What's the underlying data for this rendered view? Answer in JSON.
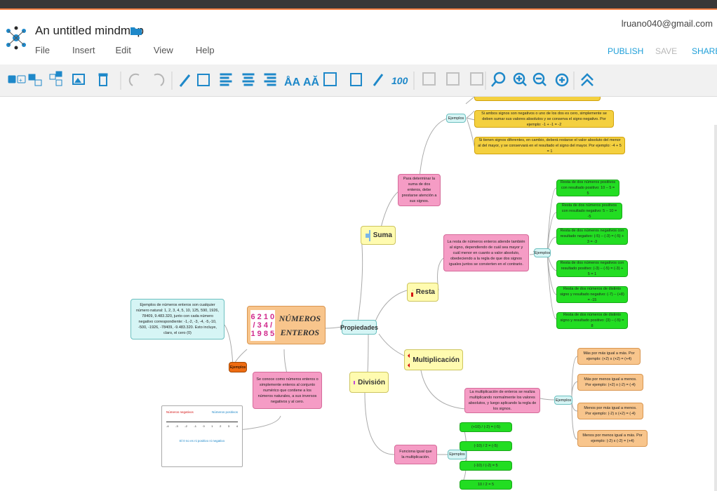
{
  "app": {
    "title": "An untitled mindmap",
    "user": "lruano040@gmail.com",
    "menu": [
      "File",
      "Insert",
      "Edit",
      "View",
      "Help"
    ],
    "buttons": {
      "publish": "PUBLISH",
      "save": "SAVE",
      "share": "SHARE"
    }
  },
  "toolbar": {
    "icons": [
      "add-topic-icon",
      "add-subtopic-icon",
      "add-relationship-icon",
      "add-image-icon",
      "delete-icon",
      "undo-icon",
      "redo-icon",
      "connector-icon",
      "text-style-icon",
      "align-left-icon",
      "align-center-icon",
      "align-right-icon",
      "font-increase-icon",
      "font-decrease-icon",
      "image-icon",
      "calendar-icon",
      "attachment-icon",
      "note-icon",
      "checklist-icon",
      "checklist-icon-2",
      "checklist-icon-3",
      "search-icon",
      "zoom-in-icon",
      "zoom-out-icon",
      "fit-icon",
      "collapse-icon"
    ]
  },
  "mindmap": {
    "center_title": "NÚMEROS ENTEROS",
    "center_digits": "6 2 1 0 / 3 4 / 1 9 8 5",
    "properties": "Propiedades",
    "suma": "Suma",
    "resta": "Resta",
    "multiplicacion": "Multiplicación",
    "division": "División",
    "ejemplos": "Ejemplos",
    "suma_desc": "Para determinar la suma de dos enteros, debe prestarse atención a sus signos.",
    "suma_ej1": "Si ambos signos son negativos o uno de los dos es cero, simplemente se deben sumar sus valores absolutos y se conserva el signo negativo. Por ejemplo: -1 + -1 = -2",
    "suma_ej2": "Si tienen signos diferentes, en cambio, deberá restarse el valor absoluto del menor al del mayor, y se conservará en el resultado el signo del mayor. Por ejemplo: -4 + 5 = 1",
    "resta_desc": "La resta de números enteros atiende también al signo, dependiendo de cuál sea mayor y cuál menor en cuanto a valor absoluto, obedeciendo a la regla de que dos signos iguales juntos se convierten en el contrario.",
    "resta_ej": [
      "Resta de dos números positivos con resultado positivo: 10 – 5 = 5",
      "Resta de dos números positivos con resultado negativo: 5 – 10 = -5",
      "Resta de dos números negativos con resultado negativo: (-5) – (-3) = (-5) + 3 = -3",
      "Resta de dos números negativos con resultado positivo: (-3) – (-5) = (-3) + 5 = 1",
      "Resta de dos números de distinto signo y resultado negativo: (-7) – (+8) = -15",
      "Resta de dos números de distinto signo y resultado positivo: (3) – (-5) = 8"
    ],
    "multi_desc": "La multiplicación de enteros se realiza multiplicando normalmente los valores absolutos, y luego aplicando la regla de los signos.",
    "multi_ej": [
      "Más por más igual a más. Por ejemplo: (+2) x (+2) = (+4)",
      "Más por menos igual a menos. Por ejemplo: (+2) x (-2) = (-4)",
      "Menos por más igual a menos. Por ejemplo: (-2) x (+2) = (-4)",
      "Menos por menos igual a más. Por ejemplo: (-2) x (-2) = (+4)"
    ],
    "division_desc": "Funciona igual que la multiplicación.",
    "division_ej": [
      "(+10) / (-2) = (-5)",
      "(-10) / 2 = (-5)",
      "(-10) / (-2) = 5",
      "10 / 2 = 5"
    ],
    "left_desc": "Se conoce como números enteros o simplemente enteros al conjunto numérico que contiene a los números naturales, a sus inversos negativos y al cero.",
    "left_ej": "Ejemplos de números enteros son cualquier número natural: 1, 2, 3, 4, 5, 10, 125, 590, 1926, 78409, 9.483.320, junto con cada número negativo correspondiente: -1,-2, -3, -4, -5,-10, -500, -1926, -78409, -9.483.320. Esto incluye, claro, el cero (0)",
    "numberline": {
      "neg_label": "Números negativos",
      "pos_label": "Números positivos",
      "ticks": [
        "-4",
        "-3",
        "-2",
        "-1",
        "0",
        "1",
        "2",
        "3",
        "4"
      ],
      "note": "El 0 no es ni positivo ni negativo"
    }
  },
  "colors": {
    "toolbar_icon": "#1e88c9",
    "accent": "#f07b3f"
  }
}
